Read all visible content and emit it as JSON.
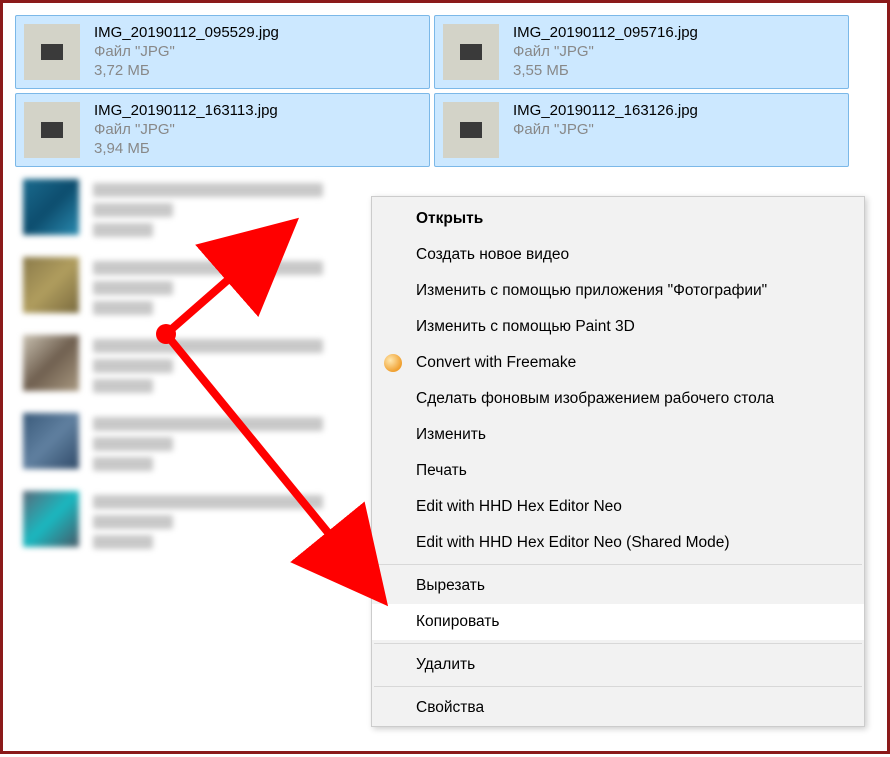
{
  "files": [
    {
      "name": "IMG_20190112_095529.jpg",
      "type": "Файл \"JPG\"",
      "size": "3,72 МБ",
      "selected": true
    },
    {
      "name": "IMG_20190112_095716.jpg",
      "type": "Файл \"JPG\"",
      "size": "3,55 МБ",
      "selected": true
    },
    {
      "name": "IMG_20190112_163113.jpg",
      "type": "Файл \"JPG\"",
      "size": "3,94 МБ",
      "selected": true
    },
    {
      "name": "IMG_20190112_163126.jpg",
      "type": "Файл \"JPG\"",
      "size": "",
      "selected": true
    }
  ],
  "context_menu": {
    "items": [
      {
        "label": "Открыть",
        "bold": true
      },
      {
        "label": "Создать новое видео"
      },
      {
        "label": "Изменить с помощью приложения \"Фотографии\""
      },
      {
        "label": "Изменить с помощью Paint 3D"
      },
      {
        "label": "Convert with Freemake",
        "icon": "freemake"
      },
      {
        "label": "Сделать фоновым изображением рабочего стола"
      },
      {
        "label": "Изменить"
      },
      {
        "label": "Печать"
      },
      {
        "label": "Edit with HHD Hex Editor Neo"
      },
      {
        "label": "Edit with HHD Hex Editor Neo (Shared Mode)"
      }
    ],
    "cut": "Вырезать",
    "copy": "Копировать",
    "delete": "Удалить",
    "properties": "Свойства"
  }
}
